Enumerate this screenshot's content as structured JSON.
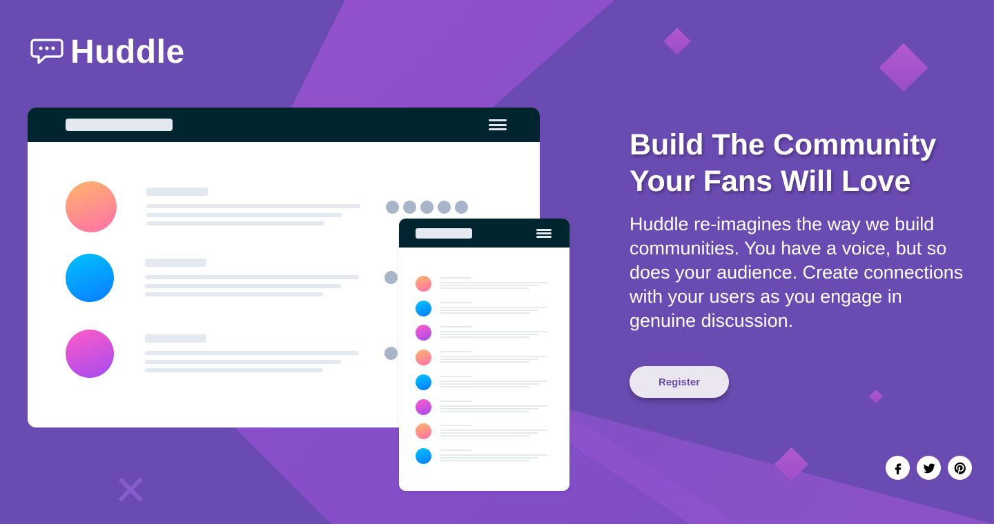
{
  "brand": {
    "name": "Huddle",
    "logo_icon": "chat-bubble-icon"
  },
  "colors": {
    "background": "#6a4bb2",
    "accent_band": "#a356d0",
    "navbar_dark": "#00252e",
    "button_bg": "#ebe7f0",
    "button_text": "#6a4bb2",
    "placeholder_gray": "#e4e8ef",
    "dot_gray": "#a8b5c9"
  },
  "hero": {
    "headline_line1": "Build The Community",
    "headline_line2": "Your Fans Will Love",
    "description": "Huddle re-imagines the way we build communities. You have a voice, but so does your audience. Create connections with your users as you engage in genuine discussion."
  },
  "cta": {
    "register_label": "Register"
  },
  "mockup": {
    "desktop_rows": [
      {
        "avatar": "orange-pink-gradient"
      },
      {
        "avatar": "blue-gradient"
      },
      {
        "avatar": "pink-purple-gradient"
      }
    ],
    "mobile_rows": [
      {
        "avatar": "orange-pink-gradient"
      },
      {
        "avatar": "blue-gradient"
      },
      {
        "avatar": "pink-purple-gradient"
      },
      {
        "avatar": "orange-pink-gradient"
      },
      {
        "avatar": "blue-gradient"
      },
      {
        "avatar": "pink-purple-gradient"
      },
      {
        "avatar": "orange-pink-gradient"
      },
      {
        "avatar": "blue-gradient"
      }
    ]
  },
  "socials": [
    {
      "name": "facebook-icon"
    },
    {
      "name": "twitter-icon"
    },
    {
      "name": "pinterest-icon"
    }
  ]
}
